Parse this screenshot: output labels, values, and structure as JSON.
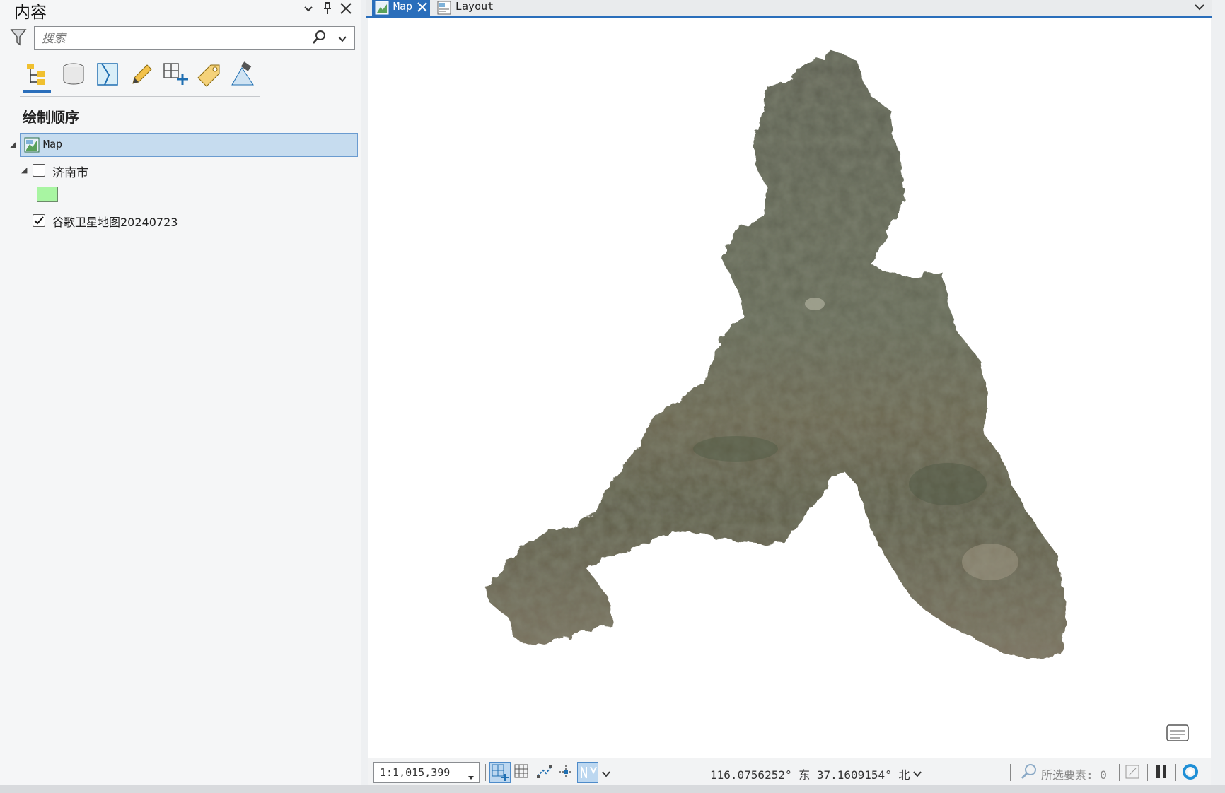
{
  "contents_pane": {
    "title": "内容",
    "search": {
      "placeholder": "搜索",
      "value": ""
    },
    "section_title": "绘制顺序",
    "tree": {
      "map_label": "Map",
      "layers": [
        {
          "label": "济南市",
          "checked": false,
          "symbol_color": "#a8f5a2"
        },
        {
          "label": "谷歌卫星地图20240723",
          "checked": true
        }
      ]
    },
    "tool_icons": [
      "list-by-drawing-order-icon",
      "list-by-data-source-icon",
      "list-by-selection-icon",
      "list-by-editing-icon",
      "list-by-snapping-icon",
      "list-by-labeling-icon",
      "list-by-perspective-imagery-icon"
    ]
  },
  "view_tabs": {
    "tabs": [
      {
        "label": "Map",
        "active": true
      },
      {
        "label": "Layout",
        "active": false
      }
    ]
  },
  "status_bar": {
    "scale": "1:1,015,399",
    "coordinates": "116.0756252° 东 37.1609154° 北",
    "selected_features": "所选要素: 0"
  },
  "colors": {
    "accent": "#2a6ebb",
    "selected_row": "#c6dcef",
    "layer_symbol": "#a8f5a2"
  }
}
